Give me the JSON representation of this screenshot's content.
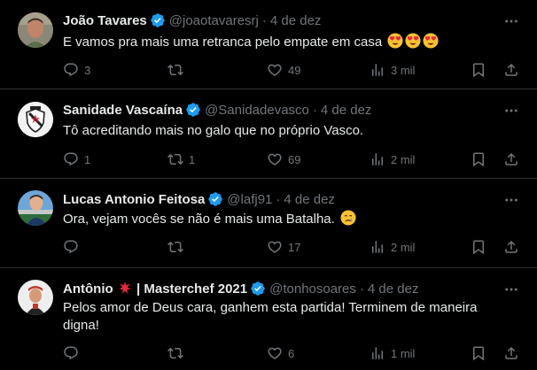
{
  "tweets": [
    {
      "name": "João Tavares",
      "handle": "@joaotavaresrj",
      "separator": "·",
      "time": "4 de dez",
      "text": "E vamos pra mais uma retranca pelo empate em casa",
      "replies": "3",
      "retweets": "",
      "likes": "49",
      "views": "3 mil"
    },
    {
      "name": "Sanidade Vascaína",
      "handle": "@Sanidadevasco",
      "separator": "·",
      "time": "4 de dez",
      "text": "Tô acreditando mais no galo que no próprio Vasco.",
      "replies": "1",
      "retweets": "1",
      "likes": "69",
      "views": "2 mil"
    },
    {
      "name": "Lucas Antonio Feitosa",
      "handle": "@lafj91",
      "separator": "·",
      "time": "4 de dez",
      "text": "Ora, vejam vocês se não é mais uma Batalha.",
      "replies": "",
      "retweets": "",
      "likes": "17",
      "views": "2 mil"
    },
    {
      "name_a": "Antônio",
      "name_b": "| Masterchef 2021",
      "handle": "@tonhosoares",
      "separator": "·",
      "time": "4 de dez",
      "text": "Pelos amor de Deus cara, ganhem esta partida! Terminem de maneira digna!",
      "replies": "",
      "retweets": "",
      "likes": "6",
      "views": "1 mil"
    }
  ],
  "colors": {
    "background": "#000000",
    "text": "#e7e9ea",
    "muted": "#71767b",
    "divider": "#2f3336",
    "verified": "#1d9bf0"
  },
  "icons": [
    "reply-icon",
    "retweet-icon",
    "like-icon",
    "views-icon",
    "bookmark-icon",
    "share-icon",
    "more-icon",
    "verified-icon"
  ]
}
